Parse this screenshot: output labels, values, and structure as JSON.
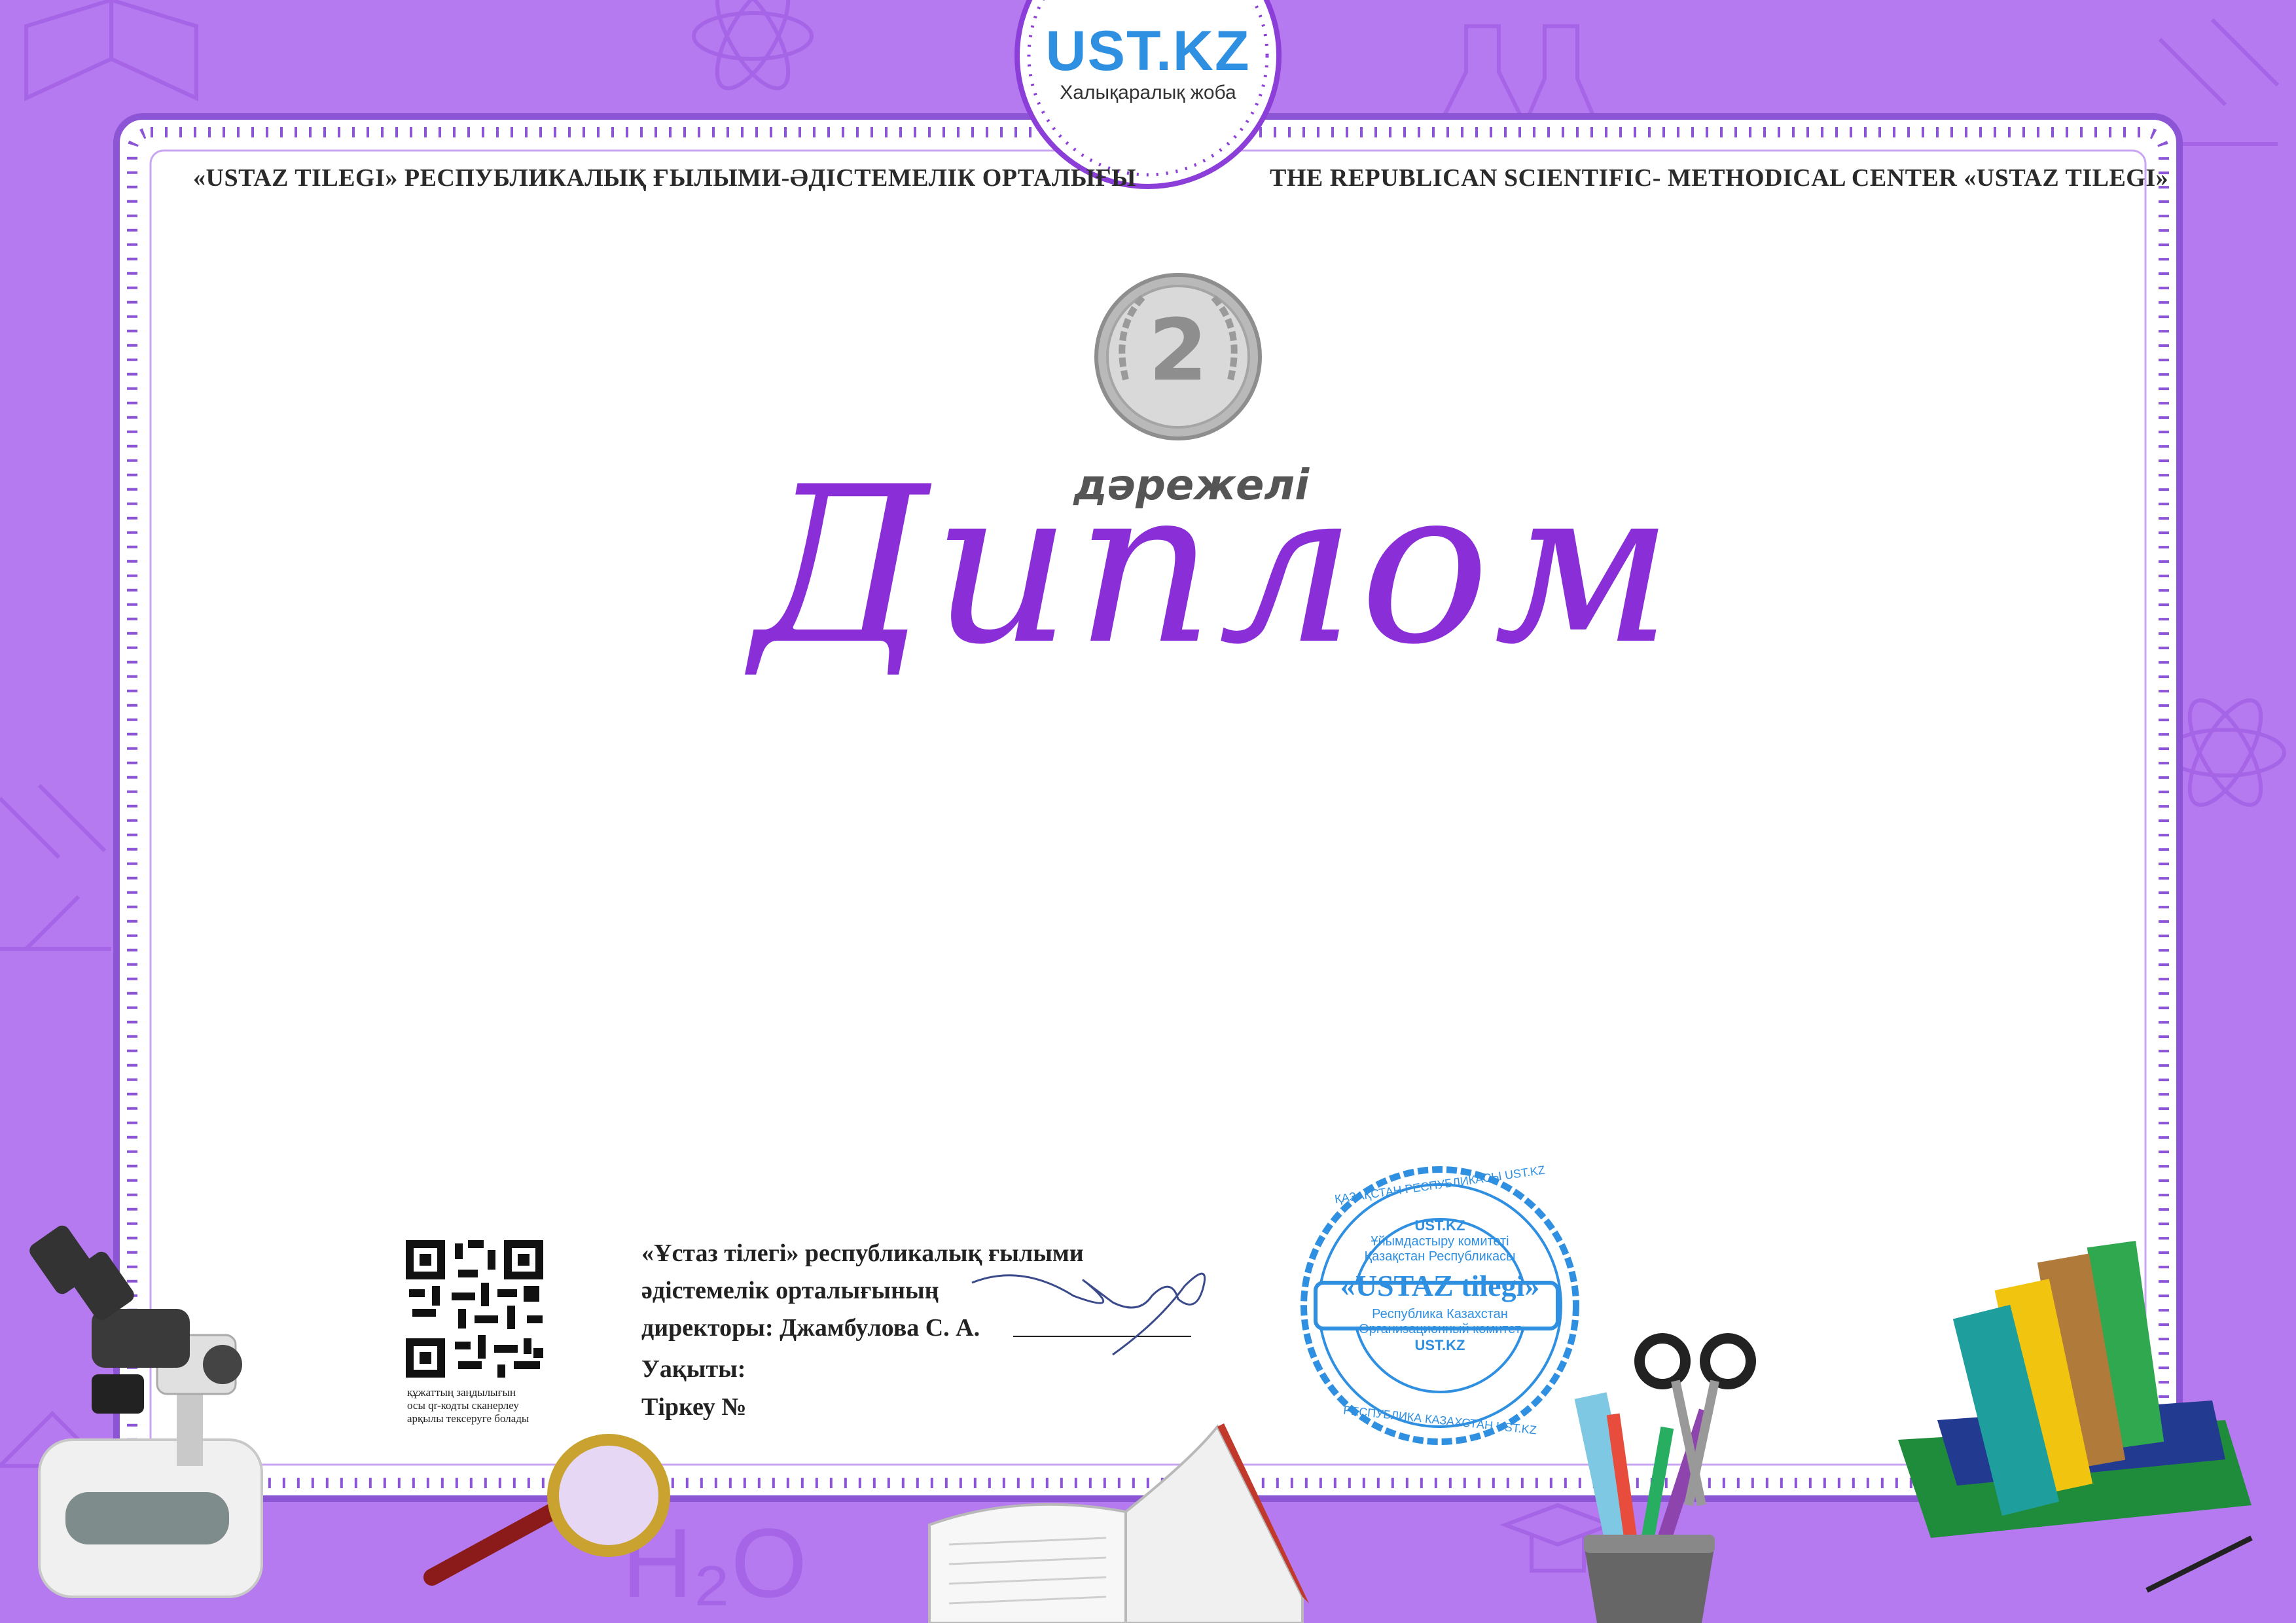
{
  "header": {
    "left": "«USTAZ TILEGI» РЕСПУБЛИКАЛЫҚ ҒЫЛЫМИ-ӘДІСТЕМЕЛІК ОРТАЛЫҒЫ",
    "right": "THE REPUBLICAN SCIENTIFIC- METHODICAL CENTER «USTAZ TILEGI»"
  },
  "logo": {
    "brand": "UST.KZ",
    "subtitle": "Халықаралық жоба"
  },
  "medal": {
    "number": "2",
    "grade_label": "дәрежелі"
  },
  "title": "Диплом",
  "signature_block": {
    "line1": "«Ұстаз тілегі» республикалық ғылыми",
    "line2": "әдістемелік орталығының",
    "line3": "директоры: Джамбулова С. А.",
    "time_label": "Уақыты:",
    "registration_label": "Тіркеу №"
  },
  "qr_caption": [
    "құжаттың заңдылығын",
    "осы qr-кодты сканерлеу",
    "арқылы тексеруге болады"
  ],
  "stamp": {
    "outer_top": "ҚАЗАҚСТАН РЕСПУБЛИКАСЫ UST.KZ",
    "outer_bottom": "РЕСПУБЛИКА КАЗАХСТАН UST.KZ",
    "inner": [
      "UST.KZ",
      "Ұйымдастыру комитеті",
      "Қазақстан Республикасы",
      "«USTAZ tilegi»",
      "Республика Казахстан",
      "Организационный комитет",
      "UST.KZ"
    ]
  },
  "colors": {
    "background": "#b57af0",
    "title": "#8a2fd8",
    "stamp": "#2f8fe0",
    "frame": "#8c55d6"
  }
}
